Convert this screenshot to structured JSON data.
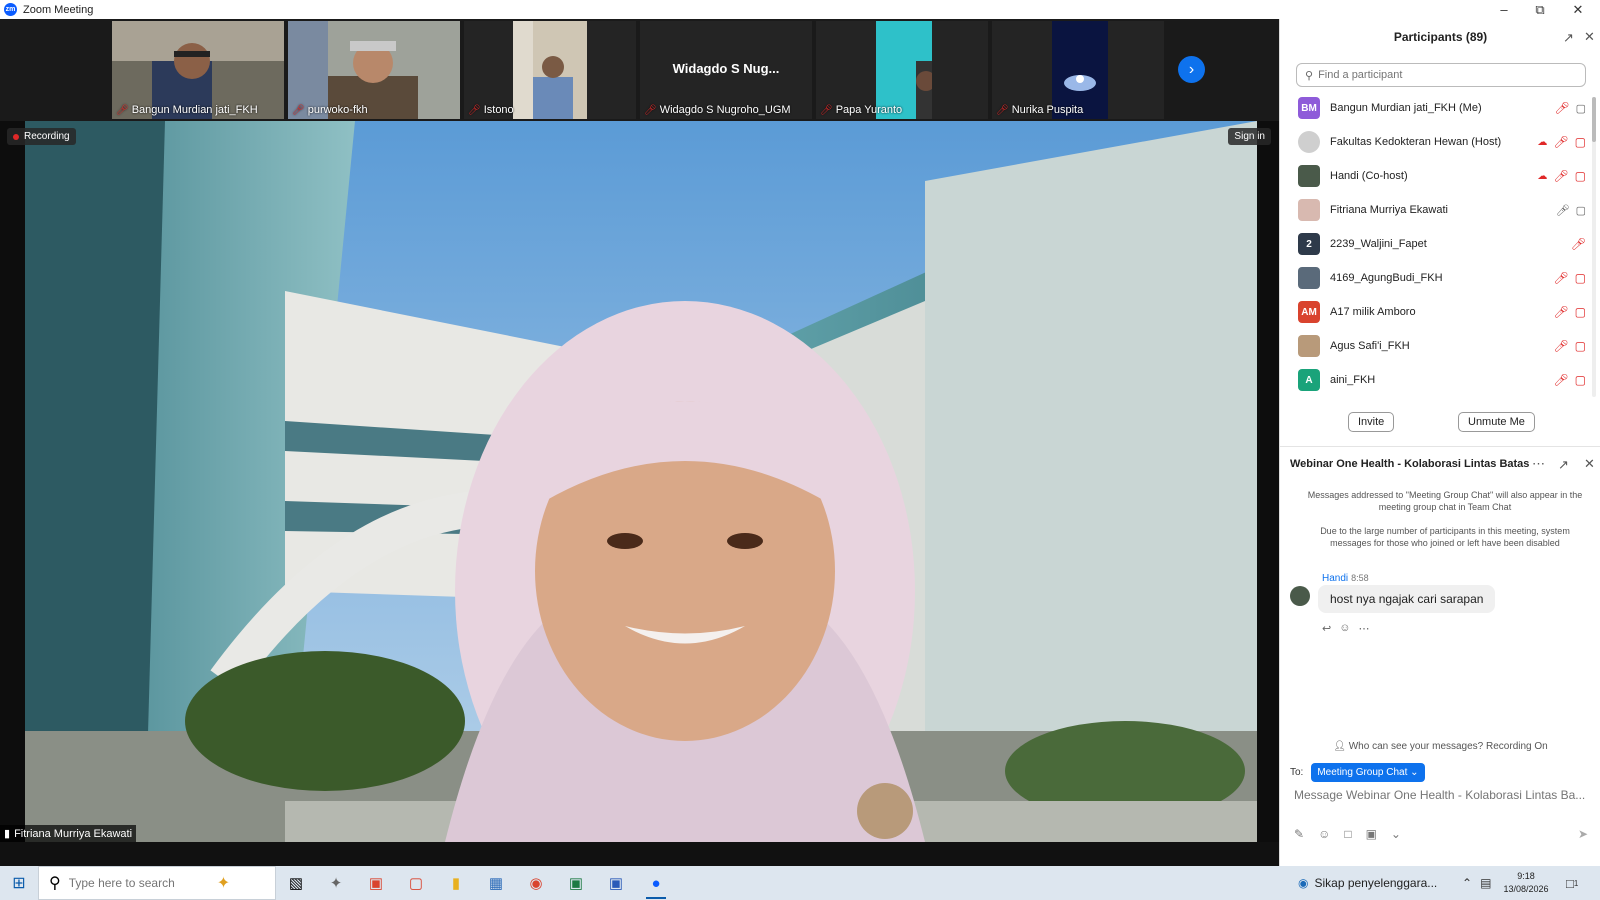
{
  "window": {
    "title": "Zoom Meeting"
  },
  "strip": {
    "tiles": [
      {
        "name": "Bangun Murdian jati_FKH"
      },
      {
        "name": "purwoko-fkh"
      },
      {
        "name": "Istono"
      },
      {
        "name": "Widagdo S Nugroho_UGM",
        "display": "Widagdo  S  Nug..."
      },
      {
        "name": "Papa Yuranto"
      },
      {
        "name": "Nurika Puspita"
      }
    ]
  },
  "video": {
    "recording_label": "Recording",
    "sign_in_label": "Sign in",
    "speaker_name": "Fitriana Murriya Ekawati"
  },
  "participants": {
    "title": "Participants (89)",
    "search_placeholder": "Find a participant",
    "list": [
      {
        "initials": "BM",
        "name": "Bangun Murdian jati_FKH (Me)",
        "color": "#8e5bd9"
      },
      {
        "initials": "",
        "name": "Fakultas Kedokteran Hewan (Host)",
        "color": "#cfcfcf"
      },
      {
        "initials": "",
        "name": "Handi (Co-host)",
        "color": "#4a5a4a"
      },
      {
        "initials": "",
        "name": "Fitriana Murriya Ekawati",
        "color": "#d8b9b0"
      },
      {
        "initials": "2",
        "name": "2239_Waljini_Fapet",
        "color": "#2e3a4a"
      },
      {
        "initials": "",
        "name": "4169_AgungBudi_FKH",
        "color": "#5a6a7a"
      },
      {
        "initials": "AM",
        "name": "A17 milik Amboro",
        "color": "#d9432e"
      },
      {
        "initials": "",
        "name": "Agus Safi'i_FKH",
        "color": "#b89a7a"
      },
      {
        "initials": "A",
        "name": "aini_FKH",
        "color": "#1aa37a"
      }
    ],
    "invite_label": "Invite",
    "unmute_label": "Unmute Me"
  },
  "chat": {
    "title": "Webinar One Health - Kolaborasi Lintas Batas",
    "note1": "Messages addressed to \"Meeting Group Chat\" will also appear in the meeting group chat in Team Chat",
    "note2": "Due to the large number of participants in this meeting, system messages for those who joined or left have been disabled",
    "message": {
      "sender": "Handi",
      "time": "8:58",
      "text": "host nya ngajak cari sarapan"
    },
    "who_can_see": "Who can see your messages? Recording On",
    "to_label": "To:",
    "to_target": "Meeting Group Chat ⌄",
    "input_placeholder": "Message Webinar One Health - Kolaborasi Lintas Ba..."
  },
  "taskbar": {
    "search_placeholder": "Type here to search",
    "news_text": "Sikap penyelenggara...",
    "time": "9:18",
    "date": "13/08/2026",
    "notification_count": "1"
  },
  "colors": {
    "zoom_blue": "#0e72ed",
    "mute_red": "#e02828"
  }
}
